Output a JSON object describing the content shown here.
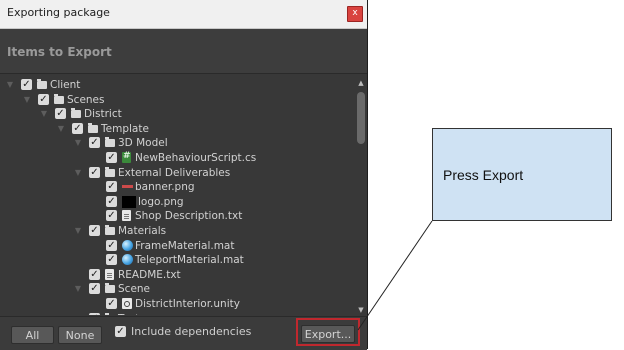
{
  "window": {
    "title": "Exporting package",
    "close_icon": "x"
  },
  "panel": {
    "heading": "Items to Export"
  },
  "tree": [
    {
      "label": "Client",
      "icon": "folder-icon",
      "checked": true,
      "expandable": true
    },
    {
      "label": "Scenes",
      "icon": "folder-icon",
      "checked": true,
      "expandable": true
    },
    {
      "label": "District",
      "icon": "folder-icon",
      "checked": true,
      "expandable": true
    },
    {
      "label": "Template",
      "icon": "folder-icon",
      "checked": true,
      "expandable": true
    },
    {
      "label": "3D Model",
      "icon": "folder-icon",
      "checked": true,
      "expandable": true
    },
    {
      "label": "NewBehaviourScript.cs",
      "icon": "csharp-script-icon",
      "checked": true,
      "expandable": false
    },
    {
      "label": "External Deliverables",
      "icon": "folder-icon",
      "checked": true,
      "expandable": true
    },
    {
      "label": "banner.png",
      "icon": "image-icon",
      "checked": true,
      "expandable": false
    },
    {
      "label": "logo.png",
      "icon": "image-icon",
      "checked": true,
      "expandable": false
    },
    {
      "label": "Shop Description.txt",
      "icon": "text-file-icon",
      "checked": true,
      "expandable": false
    },
    {
      "label": "Materials",
      "icon": "folder-icon",
      "checked": true,
      "expandable": true
    },
    {
      "label": "FrameMaterial.mat",
      "icon": "material-icon",
      "checked": true,
      "expandable": false
    },
    {
      "label": "TeleportMaterial.mat",
      "icon": "material-icon",
      "checked": true,
      "expandable": false
    },
    {
      "label": "README.txt",
      "icon": "text-file-icon",
      "checked": true,
      "expandable": false
    },
    {
      "label": "Scene",
      "icon": "folder-icon",
      "checked": true,
      "expandable": true
    },
    {
      "label": "DistrictInterior.unity",
      "icon": "unity-scene-icon",
      "checked": true,
      "expandable": false
    },
    {
      "label": "Textures",
      "icon": "folder-icon",
      "checked": true,
      "expandable": true
    }
  ],
  "footer": {
    "all_label": "All",
    "none_label": "None",
    "include_dependencies_label": "Include dependencies",
    "include_dependencies_checked": true,
    "export_label": "Export..."
  },
  "annotation": {
    "callout_text": "Press Export",
    "highlight_color": "#c0282e",
    "callout_color": "#cfe2f3"
  },
  "colors": {
    "window_bg": "#383838",
    "checkbox": "#dcdcdc",
    "text": "#d2d2d2"
  }
}
